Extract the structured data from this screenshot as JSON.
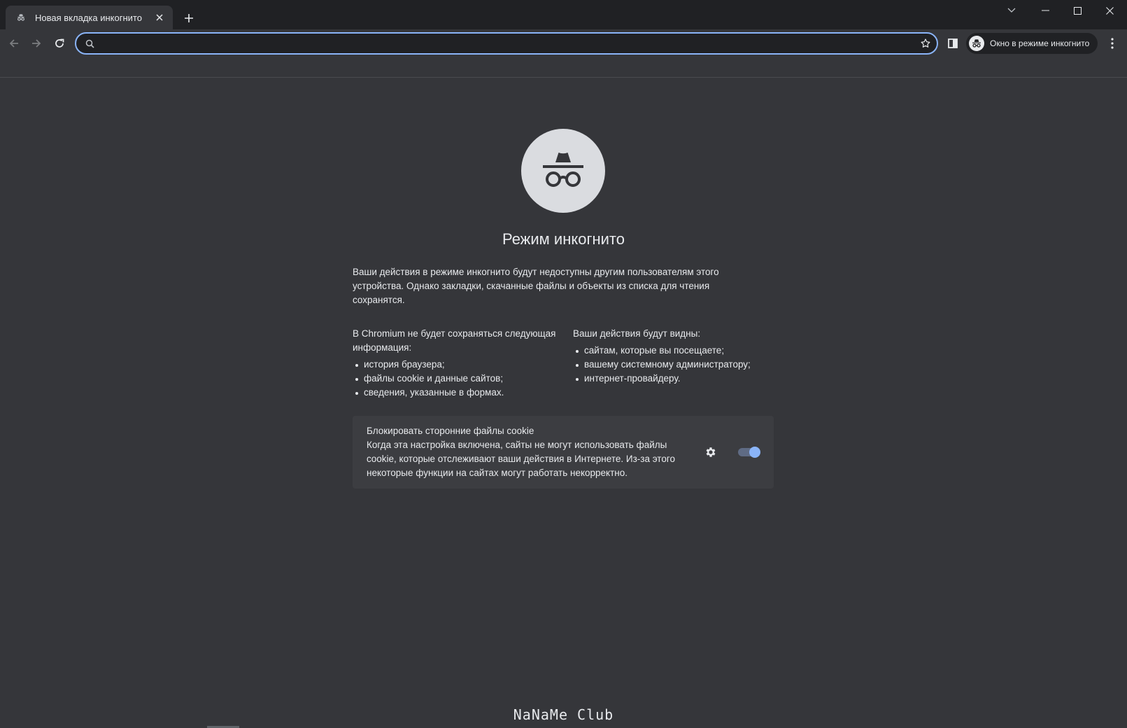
{
  "tab": {
    "title": "Новая вкладка инкогнито",
    "icon": "incognito-icon"
  },
  "toolbar": {
    "omnibox_value": "",
    "incognito_chip_label": "Окно в режиме инкогнито"
  },
  "page": {
    "title": "Режим инкогнито",
    "intro": "Ваши действия в режиме инкогнито будут недоступны другим пользователям этого устройства. Однако закладки, скачанные файлы и объекты из списка для чтения сохранятся.",
    "not_saved": {
      "heading": "В Chromium не будет сохраняться следующая информация:",
      "items": [
        "история браузера;",
        "файлы cookie и данные сайтов;",
        "сведения, указанные в формах."
      ]
    },
    "visible_to": {
      "heading": "Ваши действия будут видны:",
      "items": [
        "сайтам, которые вы посещаете;",
        "вашему системному администратору;",
        "интернет-провайдеру."
      ]
    },
    "cookie_card": {
      "title": "Блокировать сторонние файлы cookie",
      "description": "Когда эта настройка включена, сайты не могут использовать файлы cookie, которые отслеживают ваши действия в Интернете. Из-за этого некоторые функции на сайтах могут работать некорректно.",
      "toggle_on": true
    },
    "watermark": "NaNaMe Club"
  },
  "colors": {
    "background": "#35363a",
    "frame": "#202124",
    "accent": "#8ab4f8",
    "text": "#e8eaed"
  }
}
